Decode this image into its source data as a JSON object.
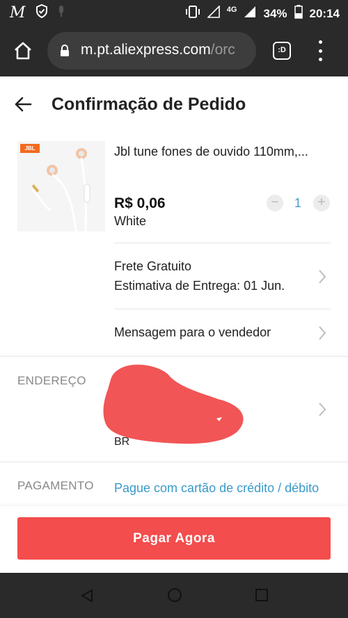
{
  "status_bar": {
    "app_glyph": "M",
    "network": "4G",
    "battery": "34%",
    "time": "20:14"
  },
  "browser": {
    "url_main": "m.pt.aliexpress.com",
    "url_rest": "/orc",
    "tabs_label": ":D"
  },
  "header": {
    "title": "Confirmação de Pedido"
  },
  "product": {
    "brand_badge": "JBL",
    "name": "Jbl tune fones de ouvido 110mm,...",
    "price": "R$ 0,06",
    "variant": "White",
    "quantity": "1",
    "minus": "−",
    "plus": "+"
  },
  "shipping": {
    "line1": "Frete Gratuito",
    "line2": "Estimativa de Entrega: 01 Jun."
  },
  "message": {
    "label": "Mensagem para o vendedor"
  },
  "address": {
    "label": "ENDEREÇO",
    "visible_fragment": "BR"
  },
  "payment": {
    "label": "PAGAMENTO",
    "method": "Pague com cartão de crédito / débito"
  },
  "footer": {
    "pay_button": "Pagar Agora"
  },
  "colors": {
    "accent_red": "#f34d4d",
    "link_blue": "#3a9ac9",
    "dark_chrome": "#2a2a2a"
  }
}
